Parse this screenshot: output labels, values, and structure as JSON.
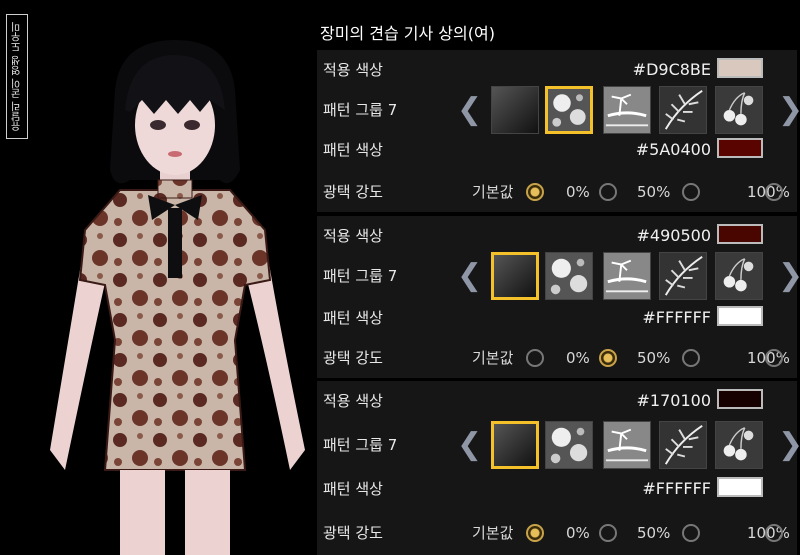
{
  "side_tag": "유달리 굳이 영생 도우미",
  "title": "장미의 견습 기사 상의(여)",
  "arrows": {
    "prev": "❮",
    "next": "❯"
  },
  "labels": {
    "apply_color": "적용 색상",
    "pattern_group": "패턴 그룹 7",
    "pattern_color": "패턴 색상",
    "gloss": "광택 강도"
  },
  "gloss_options": [
    "기본값",
    "0%",
    "50%",
    "100%"
  ],
  "sections": [
    {
      "apply_hex": "#D9C8BE",
      "apply_swatch": "#D9C8BE",
      "pattern_hex": "#5A0400",
      "pattern_swatch": "#5A0400",
      "selected_pattern": 1,
      "gloss_selected": 0
    },
    {
      "apply_hex": "#490500",
      "apply_swatch": "#490500",
      "pattern_hex": "#FFFFFF",
      "pattern_swatch": "#FFFFFF",
      "selected_pattern": 0,
      "gloss_selected": 1
    },
    {
      "apply_hex": "#170100",
      "apply_swatch": "#170100",
      "pattern_hex": "#FFFFFF",
      "pattern_swatch": "#FFFFFF",
      "selected_pattern": 0,
      "gloss_selected": 0
    }
  ],
  "pattern_icons": [
    "blank-gradient-icon",
    "hibiscus-pattern-icon",
    "palm-island-pattern-icon",
    "palm-leaf-pattern-icon",
    "cherry-pattern-icon"
  ],
  "colors": {
    "accent": "#f5c12a",
    "panel": "#161616",
    "arrow": "#8f96a6"
  }
}
